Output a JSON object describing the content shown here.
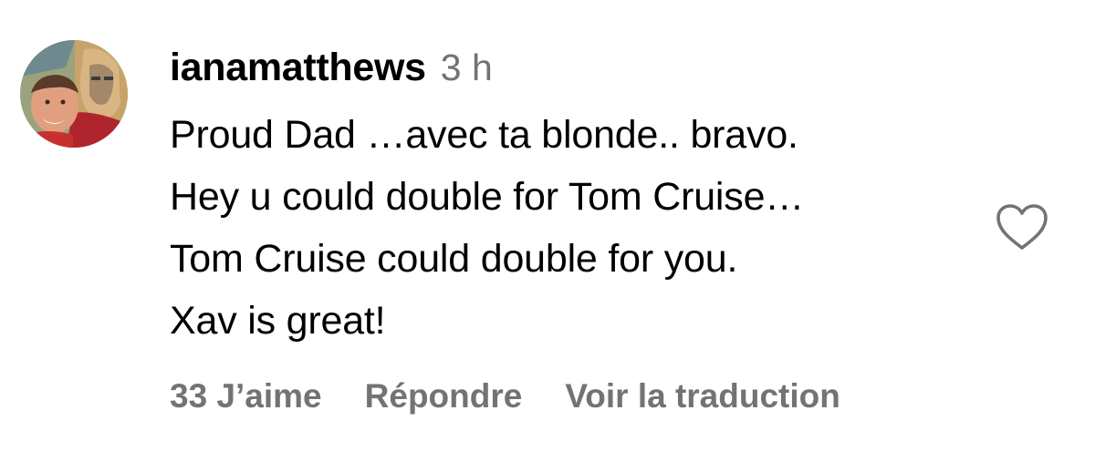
{
  "comment": {
    "username": "ianamatthews",
    "timestamp": "3 h",
    "lines": [
      "Proud Dad …avec ta blonde.. bravo.",
      "Hey u could double for Tom Cruise…",
      "Tom Cruise could double for you.",
      "Xav is great!"
    ],
    "actions": {
      "likes": "33 J’aime",
      "reply": "Répondre",
      "translate": "Voir la traduction"
    },
    "like_icon": "heart-outline-icon",
    "avatar_icon": "profile-photo"
  },
  "colors": {
    "text": "#000000",
    "secondary": "#737373",
    "icon": "#737373",
    "background": "#ffffff"
  }
}
